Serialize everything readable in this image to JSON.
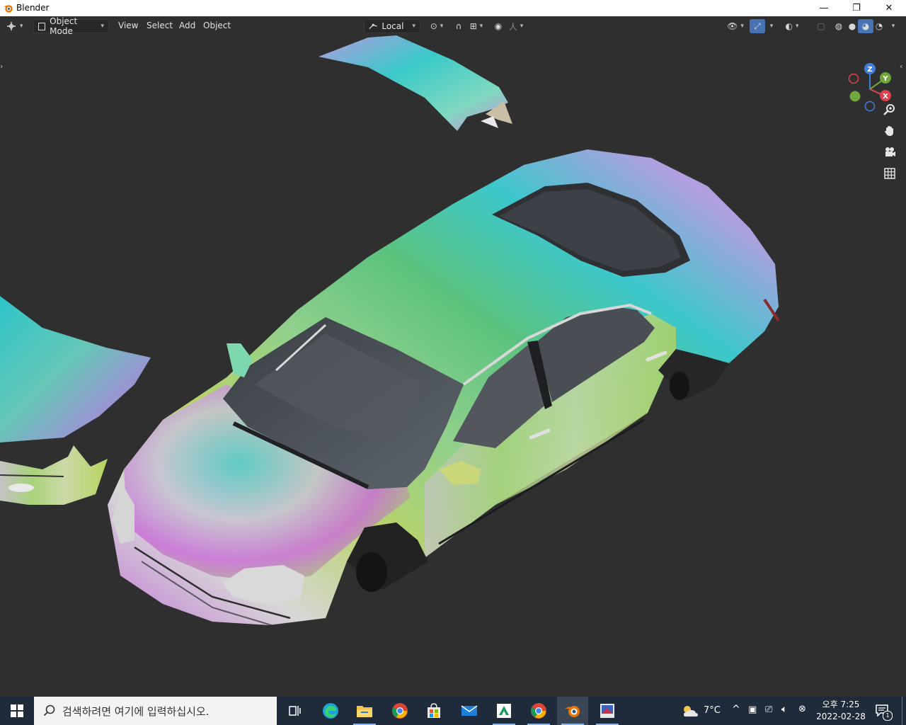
{
  "window": {
    "title": "Blender",
    "minimize_glyph": "—",
    "restore_glyph": "❐",
    "close_glyph": "✕"
  },
  "header": {
    "editor_type_icon": "editor-type-icon",
    "mode_label": "Object Mode",
    "menus": [
      "View",
      "Select",
      "Add",
      "Object"
    ],
    "transform_orientation": "Local"
  },
  "viewport": {
    "gizmo": {
      "z": "Z",
      "y": "Y",
      "x": "X"
    },
    "colors": {
      "x": "#e1414f",
      "y": "#6fa73d",
      "z": "#3f7ede",
      "active": "#4772b3"
    }
  },
  "taskbar": {
    "search_placeholder": "검색하려면 여기에 입력하십시오.",
    "apps": [
      "task-view-icon",
      "edge-icon",
      "file-explorer-icon",
      "chrome-icon",
      "store-icon",
      "mail-icon",
      "app-icon",
      "chrome-icon",
      "blender-icon",
      "image-app-icon"
    ],
    "weather": "7°C",
    "time": "오후 7:25",
    "date": "2022-02-28",
    "notification_count": "1"
  }
}
